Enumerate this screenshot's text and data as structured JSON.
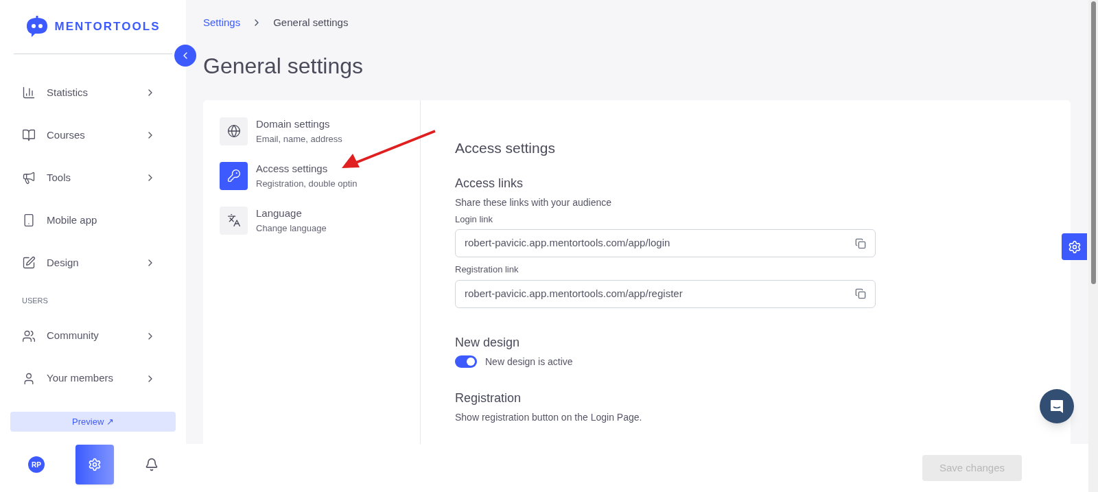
{
  "brand": {
    "name": "MENTORTOOLS"
  },
  "sidebar": {
    "items": [
      {
        "kind": "item",
        "label": "Statistics",
        "has_submenu": true
      },
      {
        "kind": "item",
        "label": "Courses",
        "has_submenu": true
      },
      {
        "kind": "item",
        "label": "Tools",
        "has_submenu": true
      },
      {
        "kind": "item",
        "label": "Mobile app",
        "has_submenu": false
      },
      {
        "kind": "item",
        "label": "Design",
        "has_submenu": true
      },
      {
        "kind": "section",
        "label": "USERS"
      },
      {
        "kind": "item",
        "label": "Community",
        "has_submenu": true
      },
      {
        "kind": "item",
        "label": "Your members",
        "has_submenu": true
      }
    ],
    "preview_button": "Preview ↗",
    "avatar": "RP"
  },
  "breadcrumb": [
    {
      "label": "Settings",
      "kind": "link"
    },
    {
      "label": "General settings",
      "kind": "current"
    }
  ],
  "page_title": "General settings",
  "settings_menu": [
    {
      "title": "Domain settings",
      "subtitle": "Email, name, address",
      "selected": false
    },
    {
      "title": "Access settings",
      "subtitle": "Registration, double optin",
      "selected": true
    },
    {
      "title": "Language",
      "subtitle": "Change language",
      "selected": false
    }
  ],
  "content": {
    "title": "Access settings",
    "sections": [
      {
        "kind": "links",
        "title": "Access links",
        "description": "Share these links with your audience",
        "fields": [
          {
            "label": "Login link",
            "value": "robert-pavicic.app.mentortools.com/app/login"
          },
          {
            "label": "Registration link",
            "value": "robert-pavicic.app.mentortools.com/app/register"
          }
        ]
      },
      {
        "kind": "toggle",
        "title": "New design",
        "toggle": {
          "label": "New design is active",
          "on": true
        }
      },
      {
        "kind": "text",
        "title": "Registration",
        "description": "Show registration button on the Login Page."
      }
    ]
  },
  "save_button": {
    "label": "Save changes",
    "disabled": true
  }
}
